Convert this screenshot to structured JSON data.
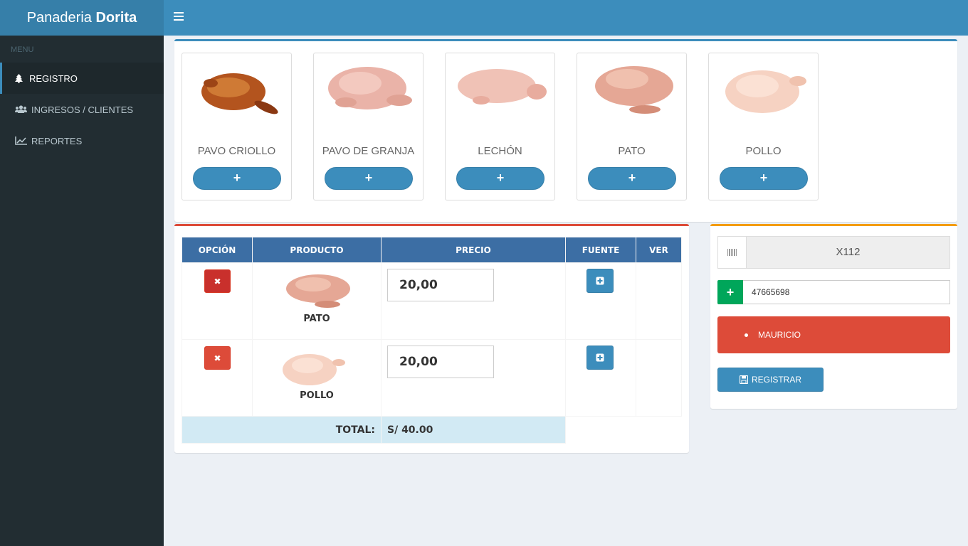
{
  "app": {
    "brand_light": "Panaderia",
    "brand_bold": "Dorita"
  },
  "sidebar": {
    "header": "MENU",
    "items": [
      {
        "label": "REGISTRO",
        "icon": "tree-icon"
      },
      {
        "label": "INGRESOS / CLIENTES",
        "icon": "users-icon"
      },
      {
        "label": "REPORTES",
        "icon": "line-chart-icon"
      }
    ]
  },
  "products": [
    {
      "name": "PAVO CRIOLLO",
      "add_label": "+"
    },
    {
      "name": "PAVO DE GRANJA",
      "add_label": "+"
    },
    {
      "name": "LECHÓN",
      "add_label": "+"
    },
    {
      "name": "PATO",
      "add_label": "+"
    },
    {
      "name": "POLLO",
      "add_label": "+"
    }
  ],
  "cart": {
    "headers": [
      "OPCIÓN",
      "PRODUCTO",
      "PRECIO",
      "FUENTE",
      "VER"
    ],
    "rows": [
      {
        "product": "PATO",
        "price": "20,00"
      },
      {
        "product": "POLLO",
        "price": "20,00"
      }
    ],
    "total_label": "TOTAL:",
    "total_value": "S/ 40.00"
  },
  "register": {
    "code": "X112",
    "phone": "47665698",
    "client": "MAURICIO",
    "button_label": "REGISTRAR"
  },
  "colors": {
    "primary": "#3c8dbc",
    "danger": "#dd4b39",
    "success": "#00a65a",
    "warning": "#f39c12",
    "sidebar": "#222d32"
  }
}
